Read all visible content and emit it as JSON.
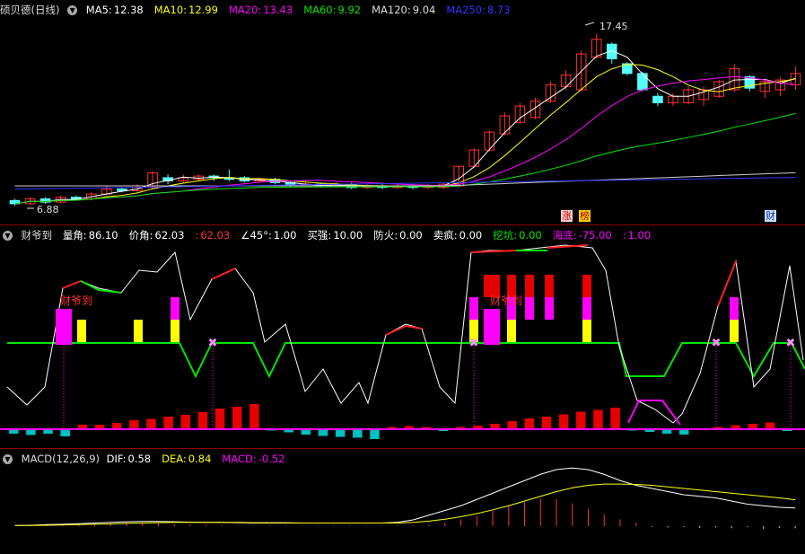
{
  "colors": {
    "up": "#ff3232",
    "down": "#54ffff",
    "ma5": "#ffffff",
    "ma10": "#ffff00",
    "ma20": "#ff00ff",
    "ma60": "#00e600",
    "ma120": "#cccccc",
    "ma250": "#3333ff",
    "green_line": "#00e600",
    "magenta": "#ff00ff",
    "yellow": "#ffff00",
    "red": "#e60000",
    "cyan": "#00c0c0",
    "grid": "#8b0000"
  },
  "price_panel": {
    "stock_name": "硕贝德(日线)",
    "ma": [
      {
        "label": "MA5:",
        "value": "12.38",
        "color": "#ffffff"
      },
      {
        "label": "MA10:",
        "value": "12.99",
        "color": "#ffff00"
      },
      {
        "label": "MA20:",
        "value": "13.43",
        "color": "#ff00ff"
      },
      {
        "label": "MA60:",
        "value": "9.92",
        "color": "#00e600"
      },
      {
        "label": "MA120:",
        "value": "9.04",
        "color": "#dddddd"
      },
      {
        "label": "MA250:",
        "value": "8.73",
        "color": "#3333ff"
      }
    ],
    "high_marker": "17.45",
    "low_marker": "6.88",
    "tags": [
      "涨",
      "榜",
      "财"
    ]
  },
  "indicator_panel": {
    "name": "财爷到",
    "items": [
      {
        "label": "量角:",
        "value": "86.10",
        "color": "#ffffff"
      },
      {
        "label": "价角:",
        "value": "62.03",
        "color": "#ffffff"
      },
      {
        "label": ":",
        "value": "62.03",
        "color": "#ff3232"
      },
      {
        "label": "∠45°:",
        "value": "1.00",
        "color": "#ffffff"
      },
      {
        "label": "买强:",
        "value": "10.00",
        "color": "#ffffff"
      },
      {
        "label": "防火:",
        "value": "0.00",
        "color": "#ffffff"
      },
      {
        "label": "卖疯:",
        "value": "0.00",
        "color": "#ffffff"
      },
      {
        "label": "挖坑:",
        "value": "0.00",
        "color": "#00e600"
      },
      {
        "label": "海底:",
        "value": "-75.00",
        "color": "#ff00ff"
      },
      {
        "label": ":",
        "value": "1.00",
        "color": "#ff00ff"
      }
    ],
    "signal_label": "财爷到"
  },
  "macd_panel": {
    "name": "MACD(12,26,9)",
    "items": [
      {
        "label": "DIF:",
        "value": "0.58",
        "color": "#ffffff"
      },
      {
        "label": "DEA:",
        "value": "0.84",
        "color": "#ffff00"
      },
      {
        "label": "MACD:",
        "value": "-0.52",
        "color": "#ff00ff"
      }
    ]
  },
  "chart_data": {
    "type": "candlestick",
    "candles": [
      {
        "o": 7.2,
        "c": 7.0,
        "h": 7.3,
        "l": 6.88
      },
      {
        "o": 7.0,
        "c": 7.3,
        "h": 7.4,
        "l": 6.95
      },
      {
        "o": 7.3,
        "c": 7.1,
        "h": 7.4,
        "l": 7.0
      },
      {
        "o": 7.1,
        "c": 7.4,
        "h": 7.5,
        "l": 7.05
      },
      {
        "o": 7.4,
        "c": 7.3,
        "h": 7.5,
        "l": 7.2
      },
      {
        "o": 7.3,
        "c": 7.6,
        "h": 7.7,
        "l": 7.2
      },
      {
        "o": 7.6,
        "c": 7.9,
        "h": 8.1,
        "l": 7.5
      },
      {
        "o": 7.9,
        "c": 7.8,
        "h": 8.0,
        "l": 7.7
      },
      {
        "o": 7.8,
        "c": 8.0,
        "h": 8.2,
        "l": 7.7
      },
      {
        "o": 8.0,
        "c": 8.9,
        "h": 9.0,
        "l": 7.9
      },
      {
        "o": 8.6,
        "c": 8.4,
        "h": 8.8,
        "l": 8.2
      },
      {
        "o": 8.4,
        "c": 8.6,
        "h": 8.8,
        "l": 8.3
      },
      {
        "o": 8.5,
        "c": 8.7,
        "h": 8.8,
        "l": 8.4
      },
      {
        "o": 8.7,
        "c": 8.6,
        "h": 8.8,
        "l": 8.4
      },
      {
        "o": 8.6,
        "c": 8.5,
        "h": 9.1,
        "l": 8.4
      },
      {
        "o": 8.6,
        "c": 8.4,
        "h": 8.7,
        "l": 8.3
      },
      {
        "o": 8.4,
        "c": 8.5,
        "h": 8.6,
        "l": 8.3
      },
      {
        "o": 8.5,
        "c": 8.3,
        "h": 8.6,
        "l": 8.2
      },
      {
        "o": 8.3,
        "c": 8.1,
        "h": 8.4,
        "l": 8.0
      },
      {
        "o": 8.1,
        "c": 8.2,
        "h": 8.3,
        "l": 8.0
      },
      {
        "o": 8.2,
        "c": 8.1,
        "h": 8.3,
        "l": 8.0
      },
      {
        "o": 8.1,
        "c": 8.2,
        "h": 8.3,
        "l": 8.0
      },
      {
        "o": 8.2,
        "c": 8.0,
        "h": 8.3,
        "l": 7.9
      },
      {
        "o": 8.0,
        "c": 8.1,
        "h": 8.2,
        "l": 7.9
      },
      {
        "o": 8.1,
        "c": 8.0,
        "h": 8.2,
        "l": 7.9
      },
      {
        "o": 8.0,
        "c": 8.1,
        "h": 8.2,
        "l": 7.9
      },
      {
        "o": 8.1,
        "c": 8.0,
        "h": 8.2,
        "l": 7.9
      },
      {
        "o": 8.0,
        "c": 8.1,
        "h": 8.2,
        "l": 7.9
      },
      {
        "o": 8.0,
        "c": 8.2,
        "h": 8.3,
        "l": 7.9
      },
      {
        "o": 8.1,
        "c": 9.3,
        "h": 9.3,
        "l": 8.0
      },
      {
        "o": 9.3,
        "c": 10.3,
        "h": 10.4,
        "l": 9.2
      },
      {
        "o": 10.3,
        "c": 11.4,
        "h": 11.5,
        "l": 10.2
      },
      {
        "o": 11.3,
        "c": 12.4,
        "h": 12.6,
        "l": 11.2
      },
      {
        "o": 12.0,
        "c": 13.0,
        "h": 13.2,
        "l": 11.9
      },
      {
        "o": 12.3,
        "c": 13.3,
        "h": 13.5,
        "l": 12.2
      },
      {
        "o": 13.3,
        "c": 14.3,
        "h": 14.5,
        "l": 13.2
      },
      {
        "o": 14.2,
        "c": 14.9,
        "h": 15.2,
        "l": 14.0
      },
      {
        "o": 14.0,
        "c": 16.2,
        "h": 16.4,
        "l": 13.9
      },
      {
        "o": 16.0,
        "c": 17.1,
        "h": 17.45,
        "l": 15.9
      },
      {
        "o": 16.8,
        "c": 15.9,
        "h": 16.9,
        "l": 15.6
      },
      {
        "o": 15.6,
        "c": 15.0,
        "h": 15.7,
        "l": 14.9
      },
      {
        "o": 15.0,
        "c": 14.0,
        "h": 15.1,
        "l": 13.9
      },
      {
        "o": 13.6,
        "c": 13.2,
        "h": 13.8,
        "l": 13.0
      },
      {
        "o": 13.2,
        "c": 13.6,
        "h": 13.8,
        "l": 13.0
      },
      {
        "o": 13.2,
        "c": 14.0,
        "h": 14.2,
        "l": 13.1
      },
      {
        "o": 13.4,
        "c": 14.0,
        "h": 14.2,
        "l": 13.0
      },
      {
        "o": 13.6,
        "c": 14.5,
        "h": 14.6,
        "l": 13.5
      },
      {
        "o": 14.0,
        "c": 15.3,
        "h": 15.6,
        "l": 13.9
      },
      {
        "o": 14.8,
        "c": 14.1,
        "h": 14.9,
        "l": 13.9
      },
      {
        "o": 13.9,
        "c": 14.5,
        "h": 14.7,
        "l": 13.5
      },
      {
        "o": 14.0,
        "c": 14.6,
        "h": 14.8,
        "l": 13.6
      },
      {
        "o": 14.3,
        "c": 15.0,
        "h": 15.4,
        "l": 14.0
      }
    ],
    "y_range": [
      6.5,
      18.3
    ],
    "indicator_histogram": [
      -1,
      -1.3,
      -1,
      -1.6,
      1,
      1,
      1.4,
      2,
      2.3,
      2.8,
      3.2,
      3.8,
      4.6,
      5,
      5.6,
      -0.3,
      -0.7,
      -1.2,
      -1.5,
      -1.7,
      -1.9,
      -2.2,
      0.5,
      0.7,
      0.5,
      -0.4,
      0.5,
      0.8,
      1.2,
      1.8,
      2.4,
      2.8,
      3.3,
      3.9,
      4.3,
      4.8,
      -0.3,
      -0.6,
      -1,
      -1.2,
      0.2,
      0.5,
      0.9,
      1.2,
      1.5,
      -0.4
    ],
    "macd_histogram": [
      0.02,
      0.03,
      0.03,
      0.04,
      0.05,
      0.06,
      0.08,
      0.1,
      0.1,
      0.08,
      0.06,
      0.05,
      0.04,
      0.03,
      0.02,
      0.02,
      0.02,
      0.02,
      0.02,
      0.02,
      0.02,
      0.02,
      0.02,
      0.02,
      0.02,
      0.02,
      0.05,
      0.1,
      0.2,
      0.3,
      0.45,
      0.6,
      0.7,
      0.8,
      0.78,
      0.66,
      0.5,
      0.34,
      0.2,
      0.1,
      -0.02,
      -0.04,
      -0.03,
      -0.05,
      -0.04,
      -0.06,
      -0.03,
      -0.08,
      -0.05,
      -0.06
    ],
    "dif": [
      0.02,
      0.03,
      0.05,
      0.06,
      0.08,
      0.1,
      0.12,
      0.14,
      0.15,
      0.15,
      0.14,
      0.13,
      0.12,
      0.12,
      0.11,
      0.1,
      0.1,
      0.1,
      0.1,
      0.1,
      0.1,
      0.1,
      0.1,
      0.1,
      0.12,
      0.2,
      0.35,
      0.5,
      0.65,
      0.85,
      1.05,
      1.25,
      1.45,
      1.65,
      1.8,
      1.85,
      1.8,
      1.65,
      1.45,
      1.3,
      1.2,
      1.1,
      1.0,
      0.95,
      0.9,
      0.8,
      0.7,
      0.65,
      0.6,
      0.58
    ],
    "dea": [
      0.02,
      0.02,
      0.03,
      0.04,
      0.05,
      0.06,
      0.07,
      0.09,
      0.1,
      0.11,
      0.12,
      0.12,
      0.12,
      0.12,
      0.12,
      0.11,
      0.11,
      0.11,
      0.1,
      0.1,
      0.1,
      0.1,
      0.1,
      0.1,
      0.1,
      0.12,
      0.16,
      0.22,
      0.3,
      0.4,
      0.52,
      0.65,
      0.8,
      0.95,
      1.1,
      1.22,
      1.3,
      1.34,
      1.34,
      1.33,
      1.3,
      1.25,
      1.2,
      1.15,
      1.1,
      1.05,
      1.0,
      0.95,
      0.9,
      0.84
    ]
  }
}
